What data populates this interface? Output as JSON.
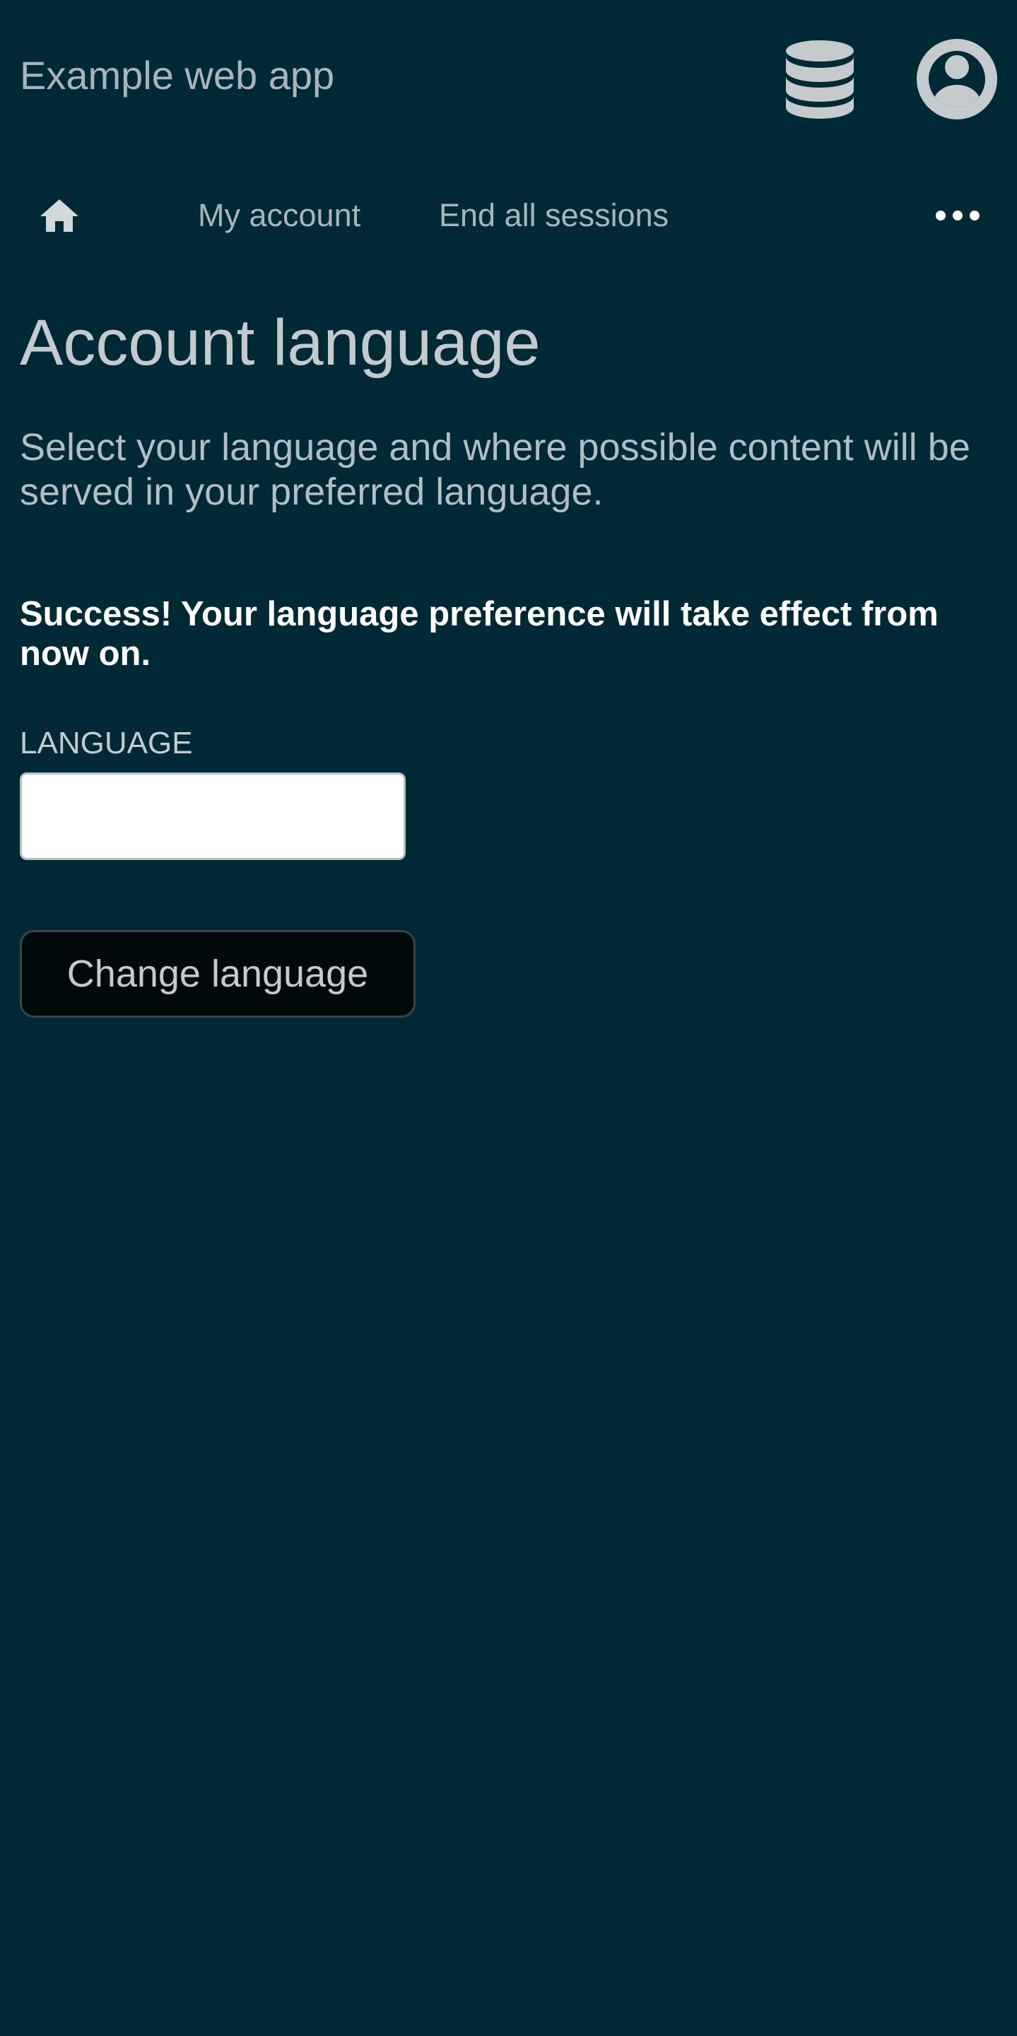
{
  "header": {
    "app_title": "Example web app",
    "database_icon": "database-icon",
    "user_icon": "user-circle-icon"
  },
  "nav": {
    "home_icon": "home-icon",
    "items": [
      {
        "label": "My account"
      },
      {
        "label": "End all sessions"
      }
    ],
    "more_icon": "more-horizontal-icon"
  },
  "main": {
    "title": "Account language",
    "intro": "Select your language and where possible content will be served in your preferred language.",
    "success_message": "Success! Your language preference will take effect from now on.",
    "language_field": {
      "label": "LANGUAGE",
      "value": ""
    },
    "submit_label": "Change language"
  },
  "colors": {
    "background": "#002936",
    "text_muted": "#a9b5b9",
    "text": "#c5cbcd",
    "success_text": "#ffffff",
    "button_background": "#02090b"
  }
}
